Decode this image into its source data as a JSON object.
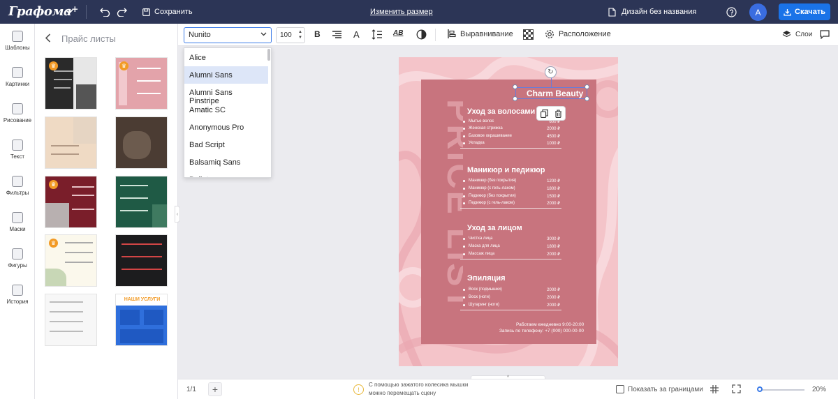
{
  "header": {
    "logo": "Графома",
    "logo_plus": "+",
    "save_label": "Сохранить",
    "resize_label": "Изменить размер",
    "design_title": "Дизайн без названия",
    "avatar_letter": "A",
    "download_label": "Скачать"
  },
  "rail": {
    "items": [
      {
        "label": "Шаблоны"
      },
      {
        "label": "Картинки"
      },
      {
        "label": "Рисование"
      },
      {
        "label": "Текст"
      },
      {
        "label": "Фильтры"
      },
      {
        "label": "Маски"
      },
      {
        "label": "Фигуры"
      },
      {
        "label": "История"
      }
    ]
  },
  "panel": {
    "title": "Прайс листы",
    "thumbs": [
      {
        "crown": "♛"
      },
      {
        "crown": "♛"
      },
      {
        "crown": ""
      },
      {
        "crown": ""
      },
      {
        "crown": "♛"
      },
      {
        "crown": ""
      },
      {
        "crown": "♛"
      },
      {
        "crown": ""
      },
      {
        "crown": ""
      },
      {
        "label": "НАШИ УСЛУГИ"
      }
    ]
  },
  "toolbar": {
    "font_value": "Nunito",
    "font_size": "100",
    "bold_label": "B",
    "text_a": "A",
    "ab_label": "AB",
    "align_label": "Выравнивание",
    "arrange_label": "Расположение",
    "layers_label": "Слои"
  },
  "font_dropdown": {
    "options": [
      "Alice",
      "Alumni Sans",
      "Alumni Sans Pinstripe",
      "Amatic SC",
      "Anonymous Pro",
      "Bad Script",
      "Balsamiq Sans",
      "Bellota"
    ],
    "selected_index": 1
  },
  "document": {
    "vertical_text": "PRICE LIST",
    "brand": "Charm Beauty",
    "sections": [
      {
        "title": "Уход за волосами",
        "items": [
          {
            "name": "Мытье волос",
            "price": "600 ₽"
          },
          {
            "name": "Женская стрижка",
            "price": "2000 ₽"
          },
          {
            "name": "Базовое окрашивание",
            "price": "4500 ₽"
          },
          {
            "name": "Укладка",
            "price": "1000 ₽"
          }
        ]
      },
      {
        "title": "Маникюр и педикюр",
        "items": [
          {
            "name": "Маникюр (без покрытия)",
            "price": "1200 ₽"
          },
          {
            "name": "Маникюр (с гель-лаком)",
            "price": "1800 ₽"
          },
          {
            "name": "Педикюр (без покрытия)",
            "price": "1500 ₽"
          },
          {
            "name": "Педикюр (с гель-лаком)",
            "price": "2000 ₽"
          }
        ]
      },
      {
        "title": "Уход за лицом",
        "items": [
          {
            "name": "Чистка лица",
            "price": "3000 ₽"
          },
          {
            "name": "Маска для лица",
            "price": "1800 ₽"
          },
          {
            "name": "Массаж лица",
            "price": "2000 ₽"
          }
        ]
      },
      {
        "title": "Эпиляция",
        "items": [
          {
            "name": "Воск (подмышки)",
            "price": "2000 ₽"
          },
          {
            "name": "Воск (ноги)",
            "price": "2000 ₽"
          },
          {
            "name": "Шугаринг (ноги)",
            "price": "2000 ₽"
          }
        ]
      }
    ],
    "footer_hours": "Работаем ежедневно 9:00-20:00",
    "footer_phone": "Запись по телефону: +7 (000) 000-00-00"
  },
  "bottom": {
    "page_count": "1/1",
    "add_page": "+",
    "hint_line1": "С помощью зажатого колесика мышки",
    "hint_line2": "можно перемещать сцену",
    "show_outside_label": "Показать за границами",
    "zoom": "20%"
  },
  "colors": {
    "topbar": "#2c3556",
    "accent": "#1a73e8",
    "doc_bg": "#c8747e",
    "canvas_bg": "#f4c4c9",
    "premium": "#f29a25"
  }
}
